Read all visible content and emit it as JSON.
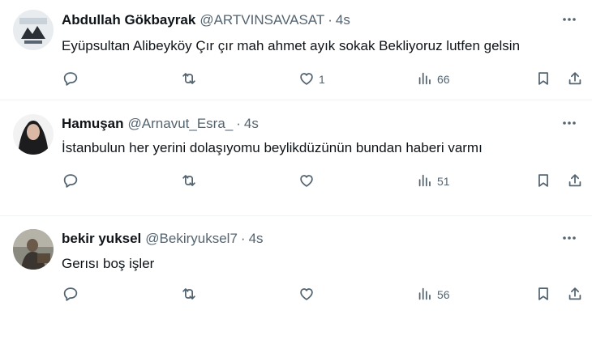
{
  "tweets": [
    {
      "name": "Abdullah Gökbayrak",
      "handle": "@ARTVINSAVASAT",
      "separator": "·",
      "time": "4s",
      "text": "Eyüpsultan Alibeyköy Çır çır mah ahmet ayık sokak Bekliyoruz lutfen gelsin",
      "likes": "1",
      "views": "66"
    },
    {
      "name": "Hamuşan",
      "handle": "@Arnavut_Esra_",
      "separator": "·",
      "time": "4s",
      "text": "İstanbulun her yerini dolaşıyomu beylikdüzünün bundan haberi varmı",
      "likes": "",
      "views": "51"
    },
    {
      "name": "bekir yuksel",
      "handle": "@Bekiryuksel7",
      "separator": "·",
      "time": "4s",
      "text": "Gerısı boş işler",
      "likes": "",
      "views": "56"
    }
  ],
  "icons": {
    "more": "more-horizontal-icon",
    "reply": "reply-bubble-icon",
    "retweet": "retweet-arrows-icon",
    "like": "heart-icon",
    "views": "views-bar-chart-icon",
    "bookmark": "bookmark-icon",
    "share": "share-upload-icon"
  },
  "colors": {
    "text": "#0f1419",
    "secondary": "#536471",
    "divider": "#eff3f4",
    "background": "#ffffff"
  }
}
